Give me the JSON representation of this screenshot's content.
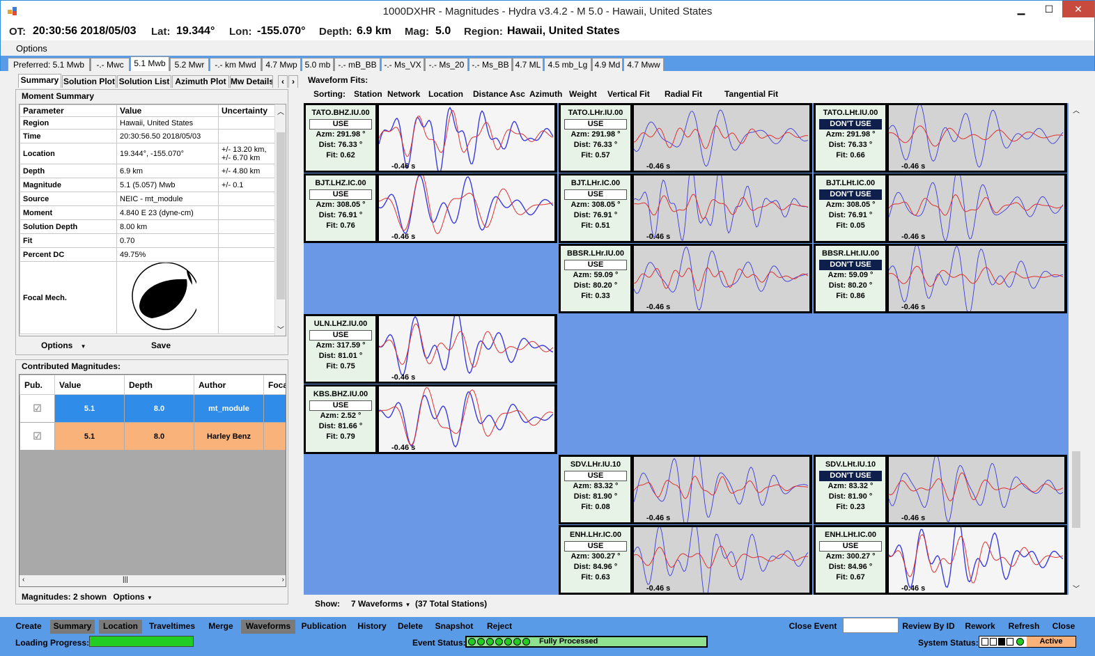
{
  "window": {
    "title": "1000DXHR - Magnitudes - Hydra v3.4.2 -  M 5.0  - Hawaii, United States",
    "min": "▁",
    "max": "☐",
    "close": "✕"
  },
  "info": {
    "ot_label": "OT:",
    "ot_value": "20:30:56 2018/05/03",
    "lat_label": "Lat:",
    "lat_value": "19.344°",
    "lon_label": "Lon:",
    "lon_value": "-155.070°",
    "depth_label": "Depth:",
    "depth_value": "6.9 km",
    "mag_label": "Mag:",
    "mag_value": "5.0",
    "region_label": "Region:",
    "region_value": "Hawaii, United States"
  },
  "menu": {
    "options": "Options"
  },
  "mag_tabs": [
    "Preferred: 5.1 Mwb",
    "-.- Mwc",
    "5.1 Mwb",
    "5.2 Mwr",
    "-.- km Mwd",
    "4.7 Mwp",
    "5.0 mb",
    "-.- mB_BB",
    "-.- Ms_VX",
    "-.- Ms_20",
    "-.- Ms_BB",
    "4.7 ML",
    "4.5 mb_Lg",
    "4.9 Md",
    "4.7 Mww"
  ],
  "sub_tabs": [
    "Summary",
    "Solution Plot",
    "Solution List",
    "Azimuth Plot",
    "Mw Details"
  ],
  "sub_tab_nav": {
    "left": "‹",
    "right": "›"
  },
  "moment_summary": {
    "title": "Moment Summary",
    "headers": [
      "Parameter",
      "Value",
      "Uncertainty"
    ],
    "rows": [
      [
        "Region",
        "Hawaii, United States",
        ""
      ],
      [
        "Time",
        "20:30:56.50 2018/05/03",
        ""
      ],
      [
        "Location",
        "19.344°, -155.070°",
        "+/- 13.20 km,\n+/- 6.70 km"
      ],
      [
        "Depth",
        "6.9 km",
        "+/- 4.80 km"
      ],
      [
        "Magnitude",
        "5.1 (5.057) Mwb",
        "+/- 0.1"
      ],
      [
        "Source",
        "NEIC - mt_module",
        ""
      ],
      [
        "Moment",
        "4.840 E 23 (dyne-cm)",
        ""
      ],
      [
        "Solution Depth",
        "8.00 km",
        ""
      ],
      [
        "Fit",
        "0.70",
        ""
      ],
      [
        "Percent DC",
        "49.75%",
        ""
      ]
    ],
    "focal_label": "Focal Mech.",
    "options_btn": "Options",
    "save_btn": "Save"
  },
  "contributed": {
    "title": "Contributed Magnitudes:",
    "headers": [
      "Pub.",
      "Value",
      "Depth",
      "Author",
      "Focal"
    ],
    "rows": [
      {
        "value": "5.1",
        "depth": "8.0",
        "author": "mt_module",
        "color": "#2f8ce8"
      },
      {
        "value": "5.1",
        "depth": "8.0",
        "author": "Harley Benz",
        "color": "#f9b27a"
      }
    ],
    "footer_label": "Magnitudes:",
    "footer_count": "2 shown",
    "footer_options": "Options"
  },
  "waveform": {
    "title": "Waveform Fits:",
    "sorting_label": "Sorting:",
    "sort_options": [
      "Station",
      "Network",
      "Location",
      "Distance Asc",
      "Azimuth",
      "Weight",
      "Vertical Fit",
      "Radial Fit",
      "Tangential Fit"
    ],
    "show_label": "Show:",
    "show_value": "7 Waveforms",
    "total": "(37 Total Stations)",
    "cells": [
      {
        "col": 0,
        "row": 0,
        "name": "TATO.BHZ.IU.00",
        "use": "USE",
        "azm": "Azm: 291.98 °",
        "dist": "Dist: 76.33 °",
        "fit": "Fit: 0.62",
        "time": "-0.46 s",
        "on": true,
        "seed": 1
      },
      {
        "col": 1,
        "row": 0,
        "name": "TATO.LHr.IU.00",
        "use": "USE",
        "azm": "Azm: 291.98 °",
        "dist": "Dist: 76.33 °",
        "fit": "Fit: 0.57",
        "time": "-0.46 s",
        "on": false,
        "seed": 2
      },
      {
        "col": 2,
        "row": 0,
        "name": "TATO.LHt.IU.00",
        "use": "DON'T USE",
        "azm": "Azm: 291.98 °",
        "dist": "Dist: 76.33 °",
        "fit": "Fit: 0.66",
        "time": "-0.46 s",
        "on": false,
        "seed": 3
      },
      {
        "col": 0,
        "row": 1,
        "name": "BJT.LHZ.IC.00",
        "use": "USE",
        "azm": "Azm: 308.05 °",
        "dist": "Dist: 76.91 °",
        "fit": "Fit: 0.76",
        "time": "-0.46 s",
        "on": true,
        "seed": 4
      },
      {
        "col": 1,
        "row": 1,
        "name": "BJT.LHr.IC.00",
        "use": "USE",
        "azm": "Azm: 308.05 °",
        "dist": "Dist: 76.91 °",
        "fit": "Fit: 0.51",
        "time": "-0.46 s",
        "on": false,
        "seed": 5
      },
      {
        "col": 2,
        "row": 1,
        "name": "BJT.LHt.IC.00",
        "use": "DON'T USE",
        "azm": "Azm: 308.05 °",
        "dist": "Dist: 76.91 °",
        "fit": "Fit: 0.05",
        "time": "-0.46 s",
        "on": false,
        "seed": 6
      },
      {
        "col": 1,
        "row": 2,
        "name": "BBSR.LHr.IU.00",
        "use": "USE",
        "azm": "Azm: 59.09 °",
        "dist": "Dist: 80.20 °",
        "fit": "Fit: 0.33",
        "time": "-0.46 s",
        "on": false,
        "seed": 7
      },
      {
        "col": 2,
        "row": 2,
        "name": "BBSR.LHt.IU.00",
        "use": "DON'T USE",
        "azm": "Azm: 59.09 °",
        "dist": "Dist: 80.20 °",
        "fit": "Fit: 0.86",
        "time": "-0.46 s",
        "on": false,
        "seed": 8
      },
      {
        "col": 0,
        "row": 3,
        "name": "ULN.LHZ.IU.00",
        "use": "USE",
        "azm": "Azm: 317.59 °",
        "dist": "Dist: 81.01 °",
        "fit": "Fit: 0.75",
        "time": "-0.46 s",
        "on": true,
        "seed": 9
      },
      {
        "col": 0,
        "row": 4,
        "name": "KBS.BHZ.IU.00",
        "use": "USE",
        "azm": "Azm: 2.52 °",
        "dist": "Dist: 81.66 °",
        "fit": "Fit: 0.79",
        "time": "-0.46 s",
        "on": true,
        "seed": 10
      },
      {
        "col": 1,
        "row": 5,
        "name": "SDV.LHr.IU.10",
        "use": "USE",
        "azm": "Azm: 83.32 °",
        "dist": "Dist: 81.90 °",
        "fit": "Fit: 0.08",
        "time": "-0.46 s",
        "on": false,
        "seed": 11
      },
      {
        "col": 2,
        "row": 5,
        "name": "SDV.LHt.IU.10",
        "use": "DON'T USE",
        "azm": "Azm: 83.32 °",
        "dist": "Dist: 81.90 °",
        "fit": "Fit: 0.23",
        "time": "-0.46 s",
        "on": false,
        "seed": 12
      },
      {
        "col": 1,
        "row": 6,
        "name": "ENH.LHr.IC.00",
        "use": "USE",
        "azm": "Azm: 300.27 °",
        "dist": "Dist: 84.96 °",
        "fit": "Fit: 0.63",
        "time": "-0.46 s",
        "on": false,
        "seed": 13
      },
      {
        "col": 2,
        "row": 6,
        "name": "ENH.LHt.IC.00",
        "use": "USE",
        "azm": "Azm: 300.27 °",
        "dist": "Dist: 84.96 °",
        "fit": "Fit: 0.67",
        "time": "-0.46 s",
        "on": true,
        "seed": 14
      }
    ]
  },
  "toolbar": {
    "left": [
      "Create",
      "Summary",
      "Location",
      "Traveltimes",
      "Merge",
      "Waveforms",
      "Publication",
      "History",
      "Delete",
      "Snapshot",
      "Reject"
    ],
    "close_event": "Close Event",
    "right": [
      "Review By ID",
      "Rework",
      "Refresh",
      "Close"
    ]
  },
  "status": {
    "loading_label": "Loading Progress:",
    "event_label": "Event Status:",
    "event_value": "Fully Processed",
    "system_label": "System Status:",
    "system_value": "Active"
  },
  "colors": {
    "accent": "#5a9be8",
    "grid_bg": "#6b98e6",
    "obs": "#3a3ae0",
    "syn": "#e03030",
    "progress": "#22cc22"
  }
}
